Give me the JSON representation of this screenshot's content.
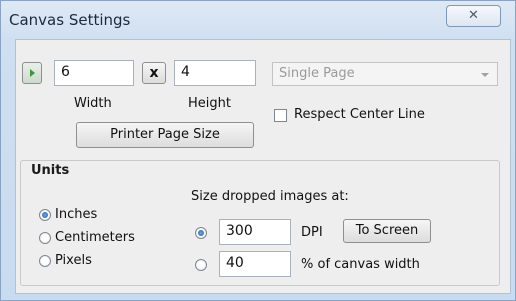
{
  "window": {
    "title": "Canvas Settings",
    "close_glyph": "✕"
  },
  "size": {
    "width_value": "6",
    "height_value": "4",
    "times_label": "x",
    "width_caption": "Width",
    "height_caption": "Height",
    "printer_button": "Printer Page Size"
  },
  "page_mode": {
    "selected": "Single Page"
  },
  "respect_center_line": {
    "label": "Respect Center Line",
    "checked": false
  },
  "units": {
    "heading": "Units",
    "options": [
      "Inches",
      "Centimeters",
      "Pixels"
    ],
    "selected": "Inches"
  },
  "dropped": {
    "heading": "Size dropped images at:",
    "dpi_value": "300",
    "dpi_label": "DPI",
    "to_screen_button": "To Screen",
    "percent_value": "40",
    "percent_label": "% of canvas width",
    "selected": "DPI"
  },
  "icons": [
    "play-icon",
    "close-icon",
    "dropdown-arrow-icon"
  ]
}
